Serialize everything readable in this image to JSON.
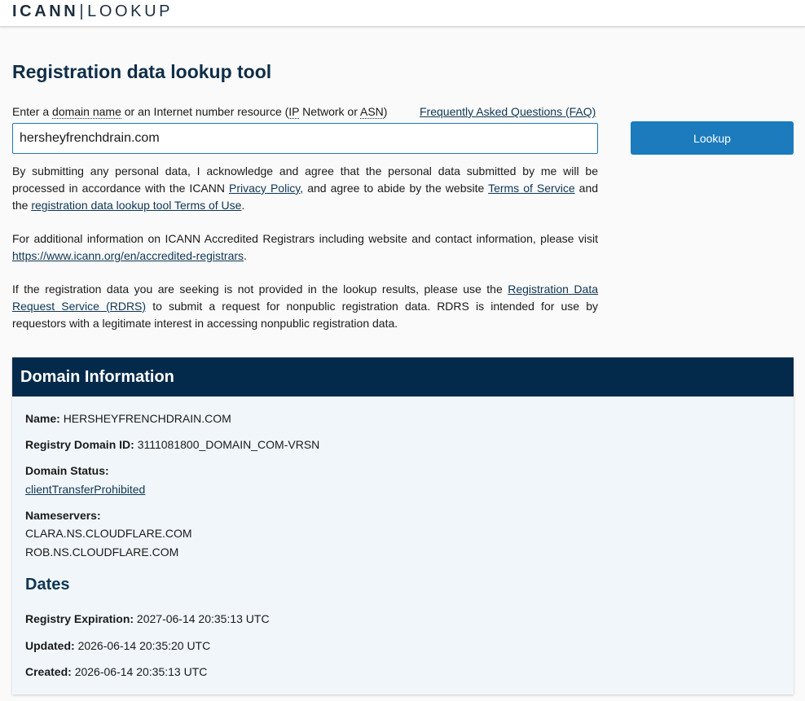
{
  "header": {
    "logo_brand": "ICANN",
    "logo_separator": "|",
    "logo_product": "LOOKUP"
  },
  "page": {
    "title": "Registration data lookup tool"
  },
  "search": {
    "prompt_enter": "Enter a",
    "prompt_domain": "domain name",
    "prompt_or": "or an Internet number resource (",
    "prompt_ip": "IP",
    "prompt_network_or": "Network or",
    "prompt_asn": "ASN",
    "prompt_close": ")",
    "faq_label": "Frequently Asked Questions (FAQ)",
    "value": "hersheyfrenchdrain.com",
    "button_label": "Lookup"
  },
  "notices": {
    "p1_before": "By submitting any personal data, I acknowledge and agree that the personal data submitted by me will be processed in accordance with the ICANN",
    "p1_privacy": "Privacy Policy",
    "p1_mid": ", and agree to abide by the website",
    "p1_tos": "Terms of Service",
    "p1_and": "and the",
    "p1_tou": "registration data lookup tool Terms of Use",
    "p1_end": ".",
    "p2_before": "For additional information on ICANN Accredited Registrars including website and contact information, please visit",
    "p2_link": "https://www.icann.org/en/accredited-registrars",
    "p2_end": ".",
    "p3_before": "If the registration data you are seeking is not provided in the lookup results, please use the",
    "p3_link": "Registration Data Request Service (RDRS)",
    "p3_after": "to submit a request for nonpublic registration data. RDRS is intended for use by requestors with a legitimate interest in accessing nonpublic registration data."
  },
  "domain_info": {
    "header": "Domain Information",
    "name_label": "Name:",
    "name_value": "HERSHEYFRENCHDRAIN.COM",
    "registry_id_label": "Registry Domain ID:",
    "registry_id_value": "3111081800_DOMAIN_COM-VRSN",
    "status_label": "Domain Status:",
    "status_value": "clientTransferProhibited",
    "nameservers_label": "Nameservers:",
    "nameservers": [
      "CLARA.NS.CLOUDFLARE.COM",
      "ROB.NS.CLOUDFLARE.COM"
    ],
    "dates_title": "Dates",
    "expiration_label": "Registry Expiration:",
    "expiration_value": "2027-06-14 20:35:13 UTC",
    "updated_label": "Updated:",
    "updated_value": "2026-06-14 20:35:20 UTC",
    "created_label": "Created:",
    "created_value": "2026-06-14 20:35:13 UTC"
  },
  "colors": {
    "header_bg": "#042a4b",
    "accent_button": "#1b7bbd",
    "link": "#0f3654",
    "card_bg": "#f0f6fa"
  }
}
